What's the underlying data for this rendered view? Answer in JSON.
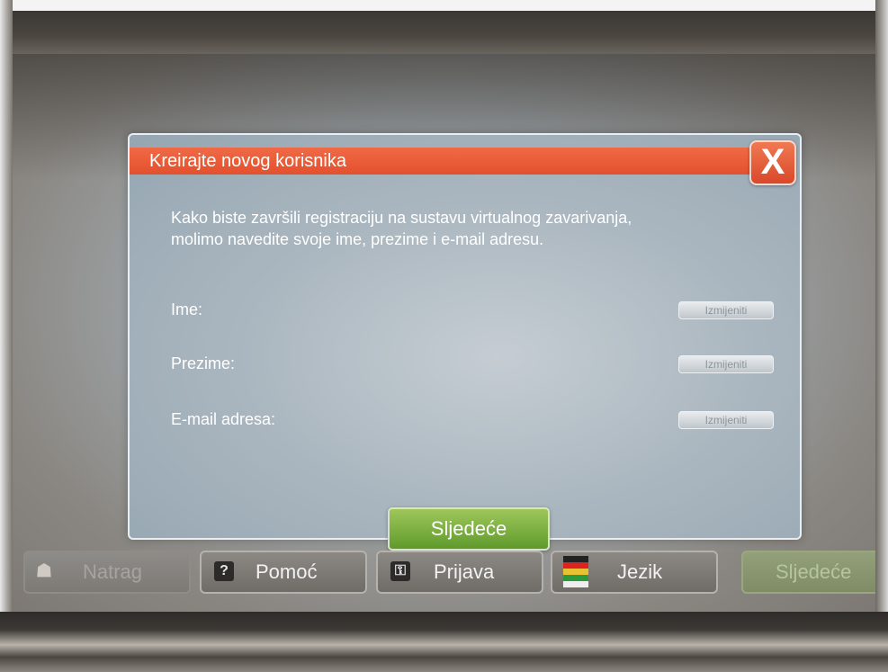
{
  "dialog": {
    "title": "Kreirajte novog korisnika",
    "close_label": "X",
    "intro_line1": "Kako biste završili registraciju na sustavu virtualnog zavarivanja,",
    "intro_line2": "molimo navedite svoje ime, prezime i e-mail adresu.",
    "fields": [
      {
        "label": "Ime:",
        "button": "Izmijeniti"
      },
      {
        "label": "Prezime:",
        "button": "Izmijeniti"
      },
      {
        "label": "E-mail adresa:",
        "button": "Izmijeniti"
      }
    ],
    "next_button": "Sljedeće"
  },
  "toolbar": {
    "back": "Natrag",
    "help": "Pomoć",
    "login": "Prijava",
    "language": "Jezik",
    "next": "Sljedeće"
  },
  "colors": {
    "header": "#e85a36",
    "next_button": "#7bb043",
    "dialog_bg": "#aab6bf"
  }
}
